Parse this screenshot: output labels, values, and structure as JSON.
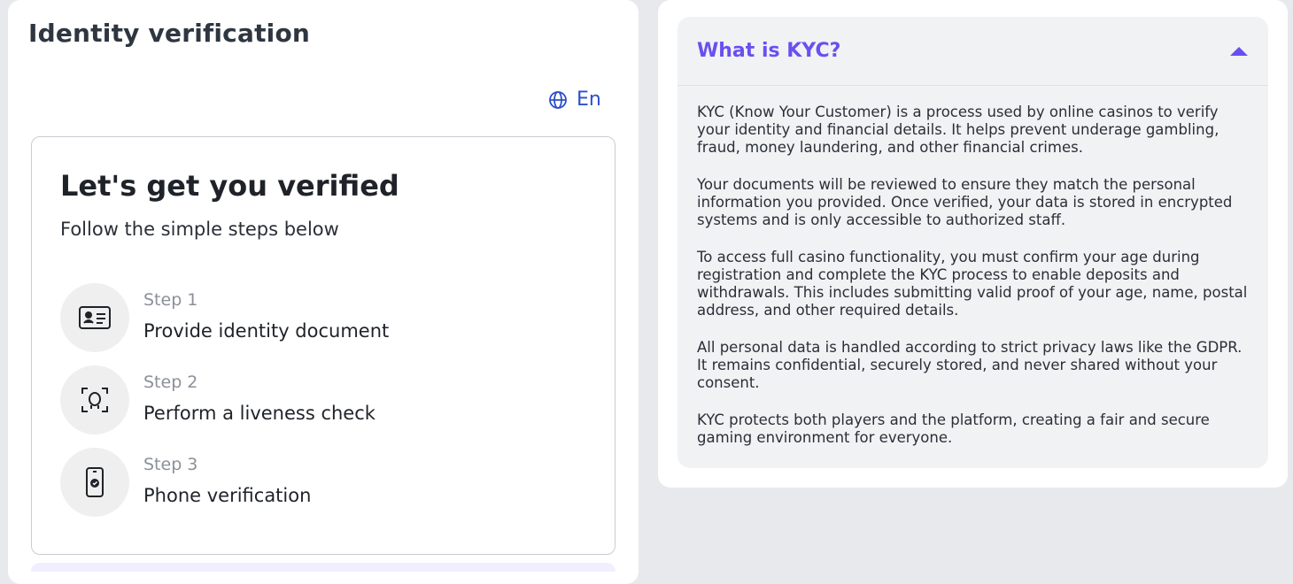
{
  "left": {
    "title": "Identity verification",
    "language": {
      "label": "En",
      "icon": "globe-icon"
    },
    "card": {
      "heading": "Let's get you verified",
      "subheading": "Follow the simple steps below",
      "steps": [
        {
          "number": "Step 1",
          "title": "Provide identity document",
          "icon": "id-card-icon"
        },
        {
          "number": "Step 2",
          "title": "Perform a liveness check",
          "icon": "face-scan-icon"
        },
        {
          "number": "Step 3",
          "title": "Phone verification",
          "icon": "phone-check-icon"
        }
      ]
    }
  },
  "right": {
    "faq": {
      "title": "What is KYC?",
      "toggle_icon": "caret-up-icon",
      "paragraphs": [
        "KYC (Know Your Customer) is a process used by online casinos to verify your identity and financial details. It helps prevent underage gambling, fraud, money laundering, and other financial crimes.",
        "Your documents will be reviewed to ensure they match the personal information you provided. Once verified, your data is stored in encrypted systems and is only accessible to authorized staff.",
        "To access full casino functionality, you must confirm your age during registration and complete the KYC process to enable deposits and withdrawals. This includes submitting valid proof of your age, name, postal address, and other required details.",
        "All personal data is handled according to strict privacy laws like the GDPR. It remains confidential, securely stored, and never shared without your consent.",
        "KYC protects both players and the platform, creating a fair and secure gaming environment for everyone."
      ]
    }
  },
  "colors": {
    "accent": "#6a4ff0",
    "link": "#2d50c8",
    "background": "#e7e9ed"
  }
}
